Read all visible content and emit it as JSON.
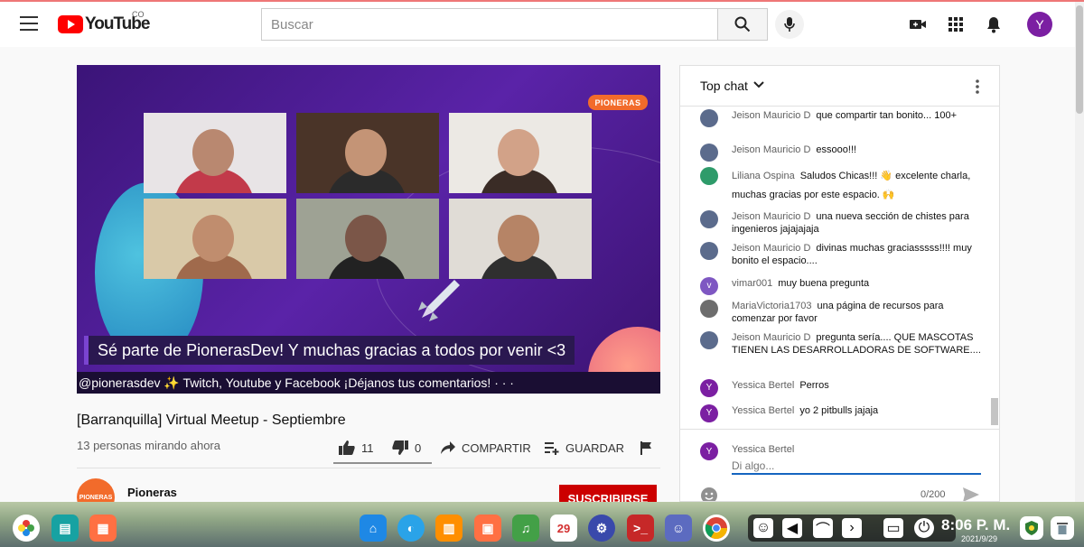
{
  "header": {
    "logo_text": "YouTube",
    "country": "CO",
    "search_placeholder": "Buscar",
    "avatar_letter": "Y"
  },
  "video": {
    "brand_badge": "PIONERAS",
    "banner": "Sé parte de PionerasDev! Y muchas gracias a todos por venir <3",
    "ticker": "@pionerasdev ✨ Twitch, Youtube y Facebook ¡Déjanos tus comentarios! · · ·",
    "title": "[Barranquilla] Virtual Meetup - Septiembre",
    "viewers": "13 personas mirando ahora",
    "likes": "11",
    "dislikes": "0",
    "share_label": "COMPARTIR",
    "save_label": "GUARDAR"
  },
  "channel": {
    "avatar_text": "PIONERAS",
    "name": "Pioneras",
    "subscribe_label": "SUSCRIBIRSE"
  },
  "chat": {
    "title": "Top chat",
    "messages": [
      {
        "author": "Jeison Mauricio D",
        "text": "que compartir tan bonito... 100+",
        "avatar": "",
        "color": "#5b6b8c"
      },
      {
        "author": "Jeison Mauricio D",
        "text": "essooo!!!",
        "avatar": "",
        "color": "#5b6b8c"
      },
      {
        "author": "Liliana Ospina",
        "text": "Saludos Chicas!!! 👋 excelente charla, muchas gracias por este espacio. 🙌",
        "avatar": "",
        "color": "#2e9b6a"
      },
      {
        "author": "Jeison Mauricio D",
        "text": "una nueva sección de chistes para ingenieros jajajajaja",
        "avatar": "",
        "color": "#5b6b8c"
      },
      {
        "author": "Jeison Mauricio D",
        "text": "divinas muchas graciasssss!!!! muy bonito el espacio....",
        "avatar": "",
        "color": "#5b6b8c"
      },
      {
        "author": "vimar001",
        "text": "muy buena pregunta",
        "avatar": "v",
        "color": "#7e57c2"
      },
      {
        "author": "MariaVictoria1703",
        "text": "una página de recursos para comenzar por favor",
        "avatar": "",
        "color": "#6d6d6d"
      },
      {
        "author": "Jeison Mauricio D",
        "text": "pregunta sería.... QUE MASCOTAS TIENEN LAS DESARROLLADORAS DE SOFTWARE....",
        "avatar": "",
        "color": "#5b6b8c"
      },
      {
        "author": "Yessica Bertel",
        "text": "Perros",
        "avatar": "Y",
        "color": "#7b1fa2"
      },
      {
        "author": "Yessica Bertel",
        "text": "yo 2 pitbulls jajaja",
        "avatar": "Y",
        "color": "#7b1fa2"
      }
    ],
    "input_author": "Yessica Bertel",
    "input_avatar": "Y",
    "input_placeholder": "Di algo...",
    "char_count": "0/200"
  },
  "taskbar": {
    "time": "8:06 P. M.",
    "date": "2021/9/29",
    "calendar_day": "29"
  }
}
